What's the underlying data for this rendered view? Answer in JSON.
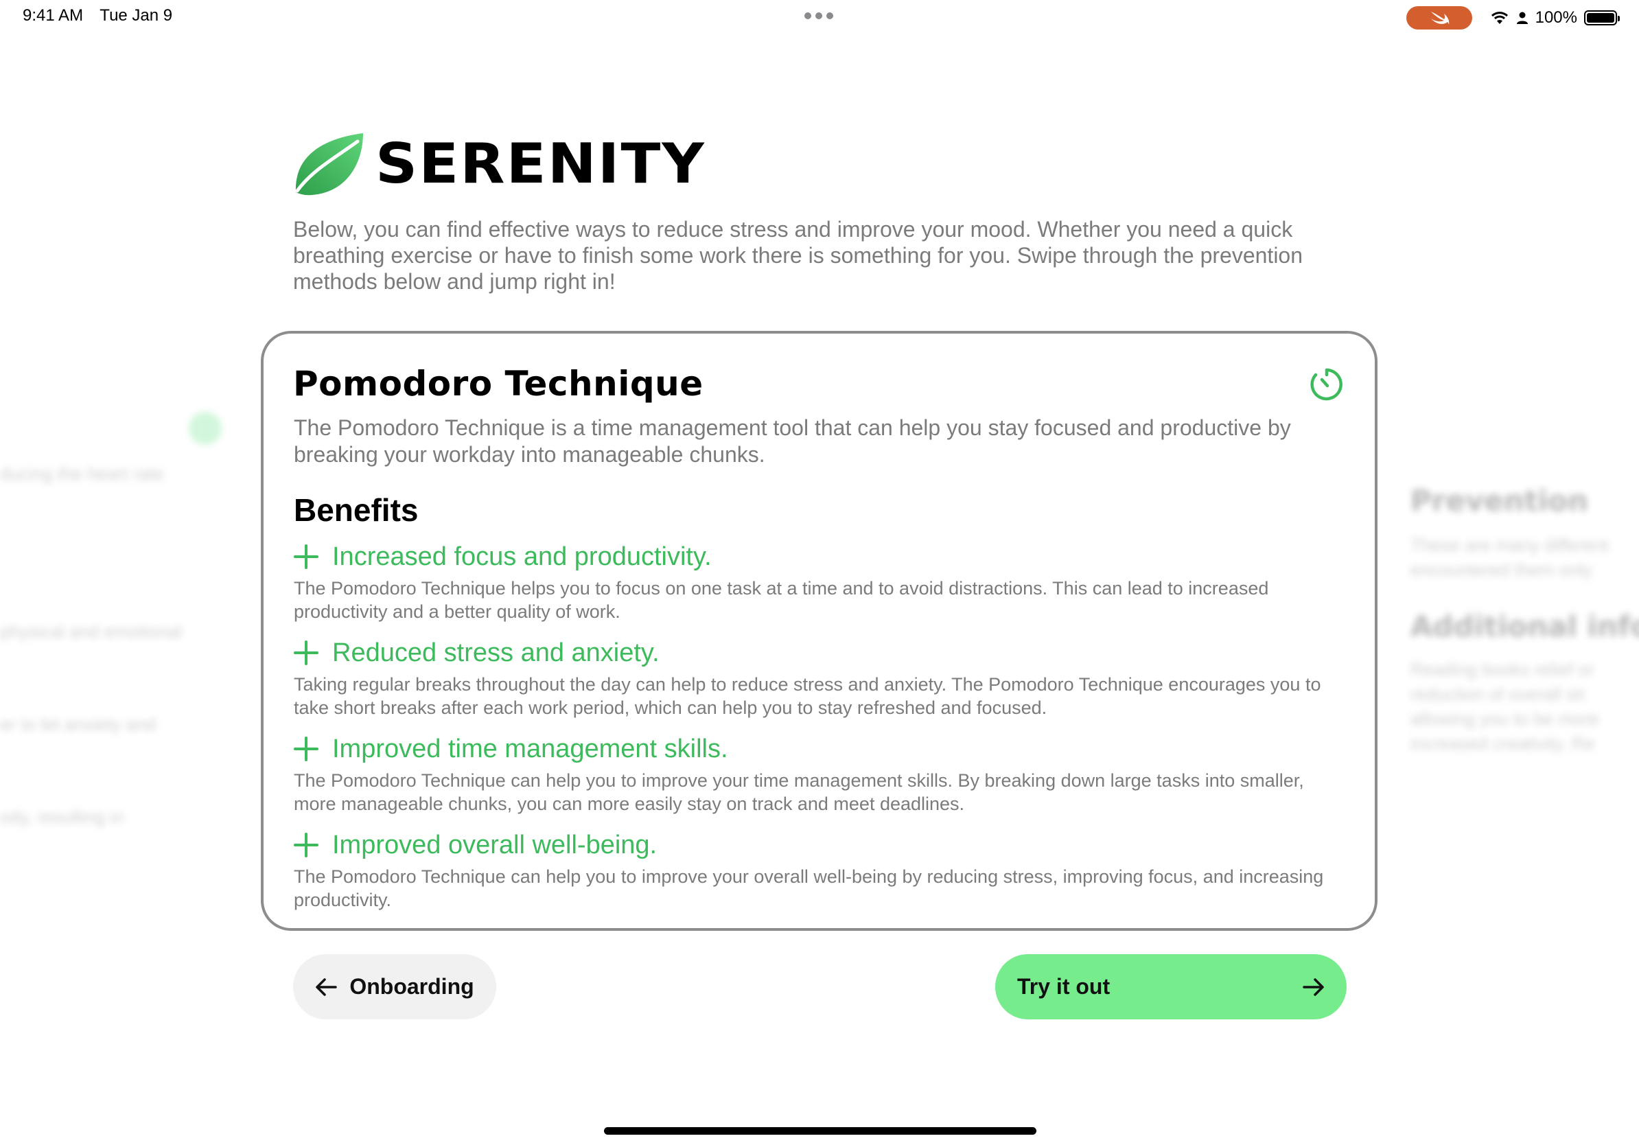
{
  "status_bar": {
    "time": "9:41 AM",
    "date": "Tue Jan 9",
    "battery": "100%",
    "icons": [
      "swift-icon",
      "wifi-icon",
      "person-icon",
      "battery-icon"
    ]
  },
  "brand": {
    "title": "SERENITY",
    "logo_icon": "leaf-icon"
  },
  "intro": "Below, you can find effective ways to reduce stress and improve your mood. Whether you need a quick breathing exercise or have to finish some work there is something for you. Swipe through the prevention methods below and jump right in!",
  "card": {
    "title": "Pomodoro Technique",
    "icon": "timer-icon",
    "description": "The Pomodoro Technique is a time management tool that can help you stay focused and productive by breaking your workday into manageable chunks.",
    "benefits_heading": "Benefits",
    "benefits": [
      {
        "title": "Increased focus and productivity.",
        "text": "The Pomodoro Technique helps you to focus on one task at a time and to avoid distractions. This can lead to increased productivity and a better quality of work."
      },
      {
        "title": "Reduced stress and anxiety.",
        "text": "Taking regular breaks throughout the day can help to reduce stress and anxiety. The Pomodoro Technique encourages you to take short breaks after each work period, which can help you to stay refreshed and focused."
      },
      {
        "title": "Improved time management skills.",
        "text": "The Pomodoro Technique can help you to improve your time management skills. By breaking down large tasks into smaller, more manageable chunks, you can more easily stay on track and meet deadlines."
      },
      {
        "title": "Improved overall well-being.",
        "text": "The Pomodoro Technique can help you to improve your overall well-being by reducing stress, improving focus, and increasing productivity."
      }
    ]
  },
  "side_cards": {
    "left_lines": [
      "ducing the heart rate",
      "physical and emotional",
      "er to let anxiety and",
      "ody, resulting in"
    ],
    "right_heading": "Prevention",
    "right_lines": [
      "These are many different",
      "encountered them only"
    ],
    "right_heading_2": "Additional information",
    "right_lines_2": [
      "Reading books relief or",
      "reduction of overall str",
      "allowing you to be more",
      "increased creativity. Re"
    ]
  },
  "buttons": {
    "back_label": "Onboarding",
    "try_label": "Try it out"
  },
  "colors": {
    "accent_green": "#3dba5c",
    "button_green": "#76ec8d",
    "swift_orange": "#d35f2e"
  }
}
